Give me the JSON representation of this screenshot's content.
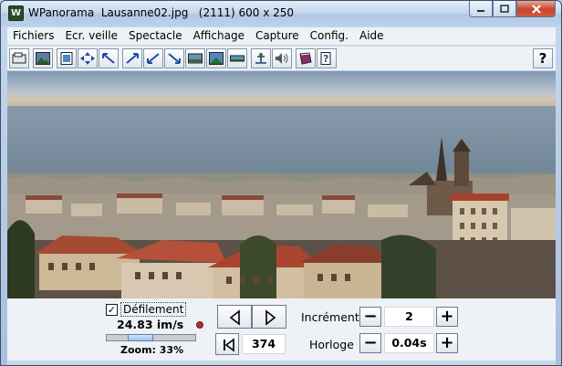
{
  "window": {
    "title": "WPanorama  Lausanne02.jpg   (2111) 600 x 250",
    "app_icon": "wpanorama-app-icon",
    "minimize": "minimize-icon",
    "maximize": "maximize-icon",
    "close": "close-icon"
  },
  "menu": {
    "items": [
      "Fichiers",
      "Ecr. veille",
      "Spectacle",
      "Affichage",
      "Capture",
      "Config.",
      "Aide"
    ]
  },
  "toolbar": {
    "buttons": [
      "open-file-icon",
      "image-icon",
      "fit-page-icon",
      "expand-icon",
      "move-left-up-icon",
      "move-right-up-icon",
      "move-left-down-icon",
      "move-right-down-icon",
      "panorama-icon",
      "landscape-icon",
      "strip-icon",
      "balance-icon",
      "sound-icon",
      "book-icon",
      "help-page-icon"
    ],
    "help_label": "?"
  },
  "panel": {
    "scroll_label": "Défilement",
    "scroll_checked": "✓",
    "speed": "24.83 im/s",
    "zoom": "Zoom: 33%",
    "zoom_fraction": 0.33,
    "position": "374",
    "increment_label": "Incrément",
    "increment_value": "2",
    "clock_label": "Horloge",
    "clock_value": "0.04s",
    "minus": "−",
    "plus": "+"
  },
  "colors": {
    "roof": "#b5503a",
    "wall": "#d8c8b0",
    "sky": "#8aa2bc",
    "lake": "#7f93a4"
  }
}
